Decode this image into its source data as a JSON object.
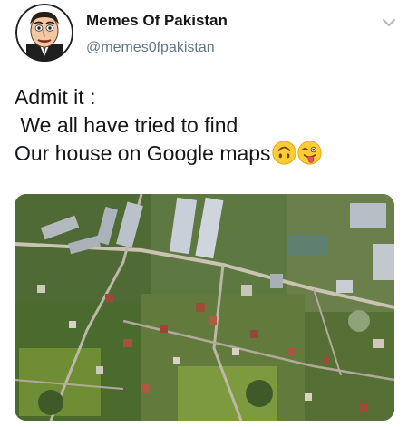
{
  "tweet": {
    "author_name": "Memes Of Pakistan",
    "author_handle": "@memes0fpakistan",
    "text_line1": "Admit it :",
    "text_line2": " We all have tried to find",
    "text_line3": "Our house on Google maps",
    "emoji_1": "upside-down-face",
    "emoji_2": "winking-face-with-tongue"
  },
  "icons": {
    "menu": "chevron-down-icon"
  },
  "colors": {
    "name": "#14171a",
    "handle": "#657786",
    "chevron": "#aab8c2"
  }
}
